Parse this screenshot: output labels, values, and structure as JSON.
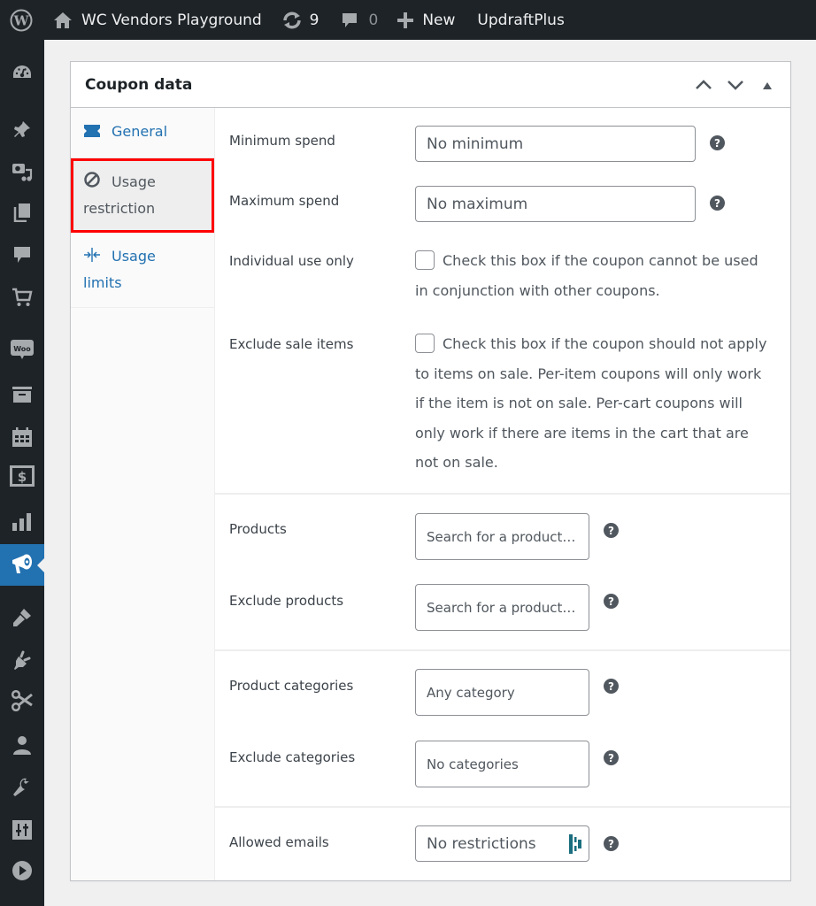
{
  "adminbar": {
    "site_name": "WC Vendors Playground",
    "updates_count": "9",
    "comments_count": "0",
    "new_label": "New",
    "updraft_label": "UpdraftPlus"
  },
  "sidemenu": {
    "items": [
      {
        "icon": "dashboard-icon"
      },
      {
        "icon": "pin-icon"
      },
      {
        "icon": "media-icon"
      },
      {
        "icon": "pages-icon"
      },
      {
        "icon": "comments-icon"
      },
      {
        "icon": "cart-icon"
      },
      {
        "icon": "woo-icon"
      },
      {
        "icon": "archive-icon"
      },
      {
        "icon": "calendar-icon"
      },
      {
        "icon": "money-icon"
      },
      {
        "icon": "chart-bar-icon"
      },
      {
        "icon": "megaphone-icon",
        "active": true
      },
      {
        "icon": "brush-icon"
      },
      {
        "icon": "plugin-icon"
      },
      {
        "icon": "scissors-icon"
      },
      {
        "icon": "user-icon"
      },
      {
        "icon": "wrench-icon"
      },
      {
        "icon": "settings-sliders-icon"
      },
      {
        "icon": "play-icon"
      }
    ]
  },
  "postbox": {
    "title": "Coupon data",
    "tabs": [
      {
        "label": "General",
        "icon": "ticket-icon"
      },
      {
        "label_line1": "Usage",
        "label_line2": "restriction",
        "icon": "no-entry-icon",
        "active": true
      },
      {
        "label_line1": "Usage",
        "label_line2": "limits",
        "icon": "arrows-in-icon"
      }
    ],
    "fields": {
      "minimum_spend": {
        "label": "Minimum spend",
        "placeholder": "No minimum"
      },
      "maximum_spend": {
        "label": "Maximum spend",
        "placeholder": "No maximum"
      },
      "individual_use": {
        "label": "Individual use only",
        "description": "Check this box if the coupon cannot be used in conjunction with other coupons.",
        "checked": false
      },
      "exclude_sale": {
        "label": "Exclude sale items",
        "description": "Check this box if the coupon should not apply to items on sale. Per-item coupons will only work if the item is not on sale. Per-cart coupons will only work if there are items in the cart that are not on sale.",
        "checked": false
      },
      "products": {
        "label": "Products",
        "placeholder": "Search for a product…"
      },
      "exclude_products": {
        "label": "Exclude products",
        "placeholder": "Search for a product…"
      },
      "product_categories": {
        "label": "Product categories",
        "placeholder": "Any category"
      },
      "exclude_categories": {
        "label": "Exclude categories",
        "placeholder": "No categories"
      },
      "allowed_emails": {
        "label": "Allowed emails",
        "placeholder": "No restrictions"
      }
    },
    "help_glyph": "?"
  },
  "colors": {
    "adminbar_bg": "#1d2327",
    "accent": "#2271b1",
    "highlight_outline": "#ff0000",
    "lastpass": "#1a6e7e"
  }
}
